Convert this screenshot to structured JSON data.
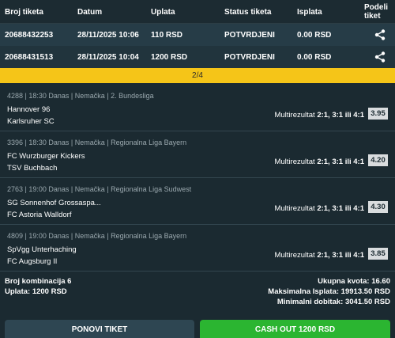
{
  "header": {
    "ticket_id": "Broj tiketa",
    "date": "Datum",
    "payment": "Uplata",
    "status": "Status tiketa",
    "payout": "Isplata",
    "share_line1": "Podeli",
    "share_line2": "tiket"
  },
  "tickets": [
    {
      "id": "20688432253",
      "date": "28/11/2025 10:06",
      "payment": "110 RSD",
      "status": "POTVRDJENI",
      "payout": "0.00 RSD"
    },
    {
      "id": "20688431513",
      "date": "28/11/2025 10:04",
      "payment": "1200 RSD",
      "status": "POTVRDJENI",
      "payout": "0.00 RSD"
    }
  ],
  "pager": "2/4",
  "matches": [
    {
      "meta": "4288 | 18:30 Danas | Nemačka | 2. Bundesliga",
      "home": "Hannover 96",
      "away": "Karlsruher SC",
      "pick_label": "Multirezultat",
      "pick_value": "2:1, 3:1 ili 4:1",
      "odd": "3.95"
    },
    {
      "meta": "3396 | 18:30 Danas | Nemačka | Regionalna Liga Bayern",
      "home": "FC Wurzburger Kickers",
      "away": "TSV Buchbach",
      "pick_label": "Multirezultat",
      "pick_value": "2:1, 3:1 ili 4:1",
      "odd": "4.20"
    },
    {
      "meta": "2763 | 19:00 Danas | Nemačka | Regionalna Liga Sudwest",
      "home": "SG Sonnenhof Grossaspa...",
      "away": "FC Astoria Walldorf",
      "pick_label": "Multirezultat",
      "pick_value": "2:1, 3:1 ili 4:1",
      "odd": "4.30"
    },
    {
      "meta": "4809 | 19:00 Danas | Nemačka | Regionalna Liga Bayern",
      "home": "SpVgg Unterhaching",
      "away": "FC Augsburg II",
      "pick_label": "Multirezultat",
      "pick_value": "2:1, 3:1 ili 4:1",
      "odd": "3.85"
    }
  ],
  "summary": {
    "combinations": "Broj kombinacija 6",
    "stake": "Uplata: 1200 RSD",
    "total_odds": "Ukupna kvota: 16.60",
    "max_payout": "Maksimalna Isplata: 19913.50 RSD",
    "min_win": "Minimalni dobitak: 3041.50 RSD"
  },
  "buttons": {
    "repeat": "PONOVI TIKET",
    "cashout": "CASH OUT 1200 RSD"
  },
  "colors": {
    "accent_yellow": "#f5c518",
    "cashout_green": "#2bb531",
    "background": "#1b2a31"
  },
  "icons": {
    "share": "share-icon"
  }
}
